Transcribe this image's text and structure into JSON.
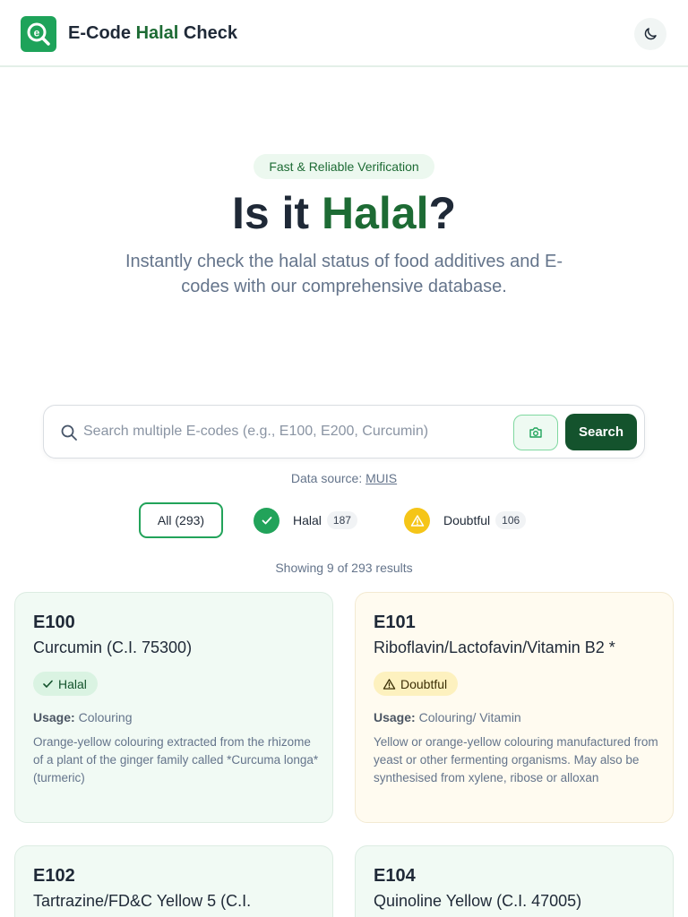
{
  "header": {
    "brand_prefix": "E-Code ",
    "brand_accent": "Halal",
    "brand_suffix": " Check",
    "logo_icon": "search-e-icon",
    "theme_icon": "moon-icon"
  },
  "hero": {
    "tagline": "Fast & Reliable Verification",
    "title_prefix": "Is it ",
    "title_accent": "Halal",
    "title_suffix": "?",
    "subtitle": "Instantly check the halal status of food additives and E-codes with our comprehensive database."
  },
  "search": {
    "placeholder": "Search multiple E-codes (e.g., E100, E200, Curcumin)",
    "value": "",
    "button_label": "Search",
    "camera_icon": "camera-icon"
  },
  "source": {
    "prefix": "Data source: ",
    "link": "MUIS"
  },
  "filters": {
    "all_label": "All (293)",
    "halal_label": "Halal",
    "halal_count": "187",
    "doubtful_label": "Doubtful",
    "doubtful_count": "106"
  },
  "results": {
    "summary": "Showing 9 of 293 results"
  },
  "colors": {
    "brand_green": "#1ea35a",
    "accent_dark_green": "#14532d",
    "halal_green": "#22a35a",
    "doubtful_yellow": "#f5c518"
  },
  "cards": [
    {
      "code": "E100",
      "name": "Curcumin (C.I. 75300)",
      "status": "Halal",
      "usage_label": "Usage:",
      "usage": "Colouring",
      "description": "Orange-yellow colouring extracted from the rhizome of a plant of the ginger family called *Curcuma longa* (turmeric)"
    },
    {
      "code": "E101",
      "name": "Riboflavin/Lactofavin/Vitamin B2 *",
      "status": "Doubtful",
      "usage_label": "Usage:",
      "usage": "Colouring/ Vitamin",
      "description": "Yellow or orange-yellow colouring manufactured from yeast or other fermenting organisms. May also be synthesised from xylene, ribose or alloxan"
    },
    {
      "code": "E102",
      "name": "Tartrazine/FD&C Yellow 5 (C.I."
    },
    {
      "code": "E104",
      "name": "Quinoline Yellow (C.I. 47005)"
    }
  ]
}
